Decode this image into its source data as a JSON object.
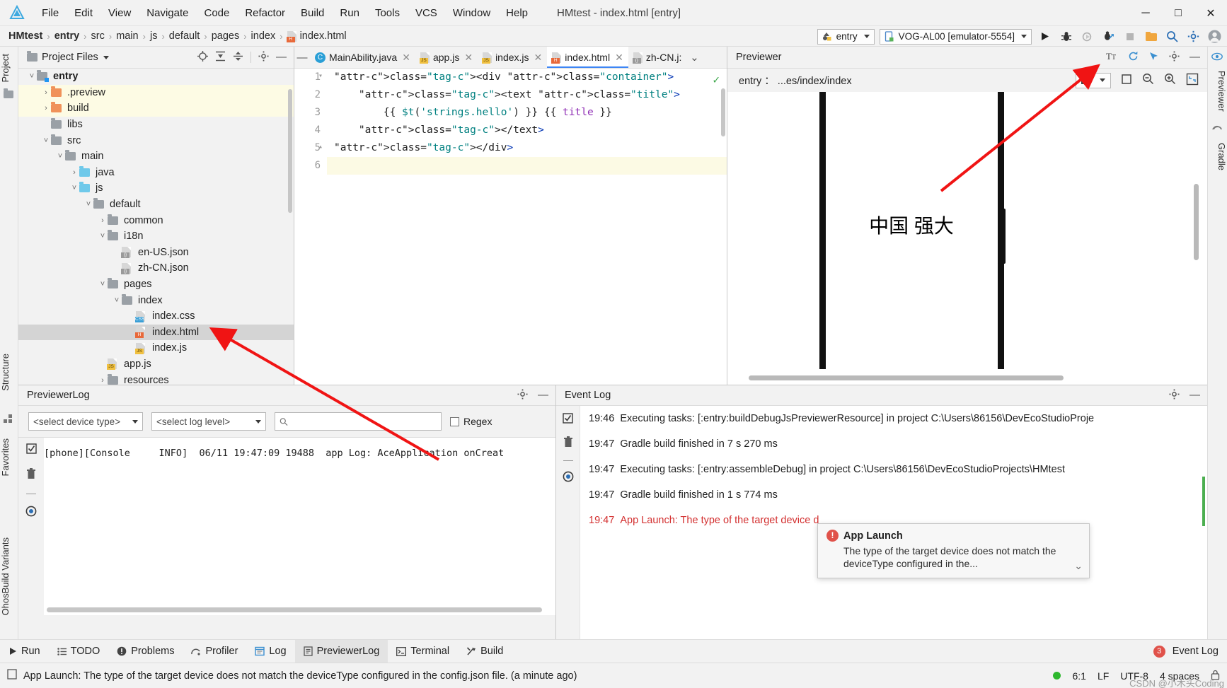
{
  "window": {
    "title": "HMtest - index.html [entry]",
    "app_icon": "deveco-studio-logo",
    "minimize": "─",
    "maximize": "□",
    "close": "✕"
  },
  "menubar": {
    "items": [
      "File",
      "Edit",
      "View",
      "Navigate",
      "Code",
      "Refactor",
      "Build",
      "Run",
      "Tools",
      "VCS",
      "Window",
      "Help"
    ]
  },
  "breadcrumb": {
    "items": [
      "HMtest",
      "entry",
      "src",
      "main",
      "js",
      "default",
      "pages",
      "index"
    ],
    "file": "index.html",
    "separator": "›"
  },
  "toolbar": {
    "run_config": "entry",
    "device": "VOG-AL00 [emulator-5554]",
    "icons": [
      "run-icon",
      "debug-icon",
      "run-coverage-icon",
      "profile-icon",
      "stop-icon",
      "device-manager-icon",
      "search-everywhere-icon",
      "settings-icon",
      "account-icon"
    ]
  },
  "left_strip": {
    "tabs": [
      "Project",
      "Structure",
      "Favorites",
      "OhosBuild Variants"
    ]
  },
  "right_strip": {
    "tabs": [
      "Previewer",
      "Gradle"
    ]
  },
  "project_panel": {
    "title": "Project Files",
    "head_icons": [
      "locate-icon",
      "expand-all-icon",
      "collapse-all-icon",
      "gear-icon",
      "hide-icon"
    ],
    "tree": [
      {
        "label": "entry",
        "depth": 0,
        "twisty": "v",
        "icon": "module-folder",
        "bold": true,
        "state": "normal"
      },
      {
        "label": ".preview",
        "depth": 1,
        "twisty": ">",
        "icon": "folder-orange",
        "bold": false,
        "state": "highlight"
      },
      {
        "label": "build",
        "depth": 1,
        "twisty": ">",
        "icon": "folder-orange",
        "bold": false,
        "state": "highlight"
      },
      {
        "label": "libs",
        "depth": 1,
        "twisty": "",
        "icon": "folder-gray",
        "bold": false,
        "state": "normal"
      },
      {
        "label": "src",
        "depth": 1,
        "twisty": "v",
        "icon": "folder-gray",
        "bold": false,
        "state": "normal"
      },
      {
        "label": "main",
        "depth": 2,
        "twisty": "v",
        "icon": "folder-gray",
        "bold": false,
        "state": "normal"
      },
      {
        "label": "java",
        "depth": 3,
        "twisty": ">",
        "icon": "folder-blue",
        "bold": false,
        "state": "normal"
      },
      {
        "label": "js",
        "depth": 3,
        "twisty": "v",
        "icon": "folder-blue",
        "bold": false,
        "state": "normal"
      },
      {
        "label": "default",
        "depth": 4,
        "twisty": "v",
        "icon": "folder-gray",
        "bold": false,
        "state": "normal"
      },
      {
        "label": "common",
        "depth": 5,
        "twisty": ">",
        "icon": "folder-gray",
        "bold": false,
        "state": "normal"
      },
      {
        "label": "i18n",
        "depth": 5,
        "twisty": "v",
        "icon": "folder-gray",
        "bold": false,
        "state": "normal"
      },
      {
        "label": "en-US.json",
        "depth": 6,
        "twisty": "",
        "icon": "file-json",
        "bold": false,
        "state": "normal"
      },
      {
        "label": "zh-CN.json",
        "depth": 6,
        "twisty": "",
        "icon": "file-json",
        "bold": false,
        "state": "normal"
      },
      {
        "label": "pages",
        "depth": 5,
        "twisty": "v",
        "icon": "folder-gray",
        "bold": false,
        "state": "normal"
      },
      {
        "label": "index",
        "depth": 6,
        "twisty": "v",
        "icon": "folder-gray",
        "bold": false,
        "state": "normal"
      },
      {
        "label": "index.css",
        "depth": 7,
        "twisty": "",
        "icon": "file-css",
        "bold": false,
        "state": "normal"
      },
      {
        "label": "index.html",
        "depth": 7,
        "twisty": "",
        "icon": "file-html",
        "bold": false,
        "state": "selected"
      },
      {
        "label": "index.js",
        "depth": 7,
        "twisty": "",
        "icon": "file-js",
        "bold": false,
        "state": "normal"
      },
      {
        "label": "app.js",
        "depth": 5,
        "twisty": "",
        "icon": "file-js",
        "bold": false,
        "state": "normal"
      },
      {
        "label": "resources",
        "depth": 5,
        "twisty": ">",
        "icon": "folder-gray",
        "bold": false,
        "state": "normal"
      }
    ]
  },
  "editor": {
    "tabs": [
      {
        "label": "MainAbility.java",
        "icon": "java-class-icon",
        "active": false
      },
      {
        "label": "app.js",
        "icon": "js-file-icon",
        "active": false
      },
      {
        "label": "index.js",
        "icon": "js-file-icon",
        "active": false
      },
      {
        "label": "index.html",
        "icon": "html-file-icon",
        "active": true
      },
      {
        "label": "zh-CN.j:",
        "icon": "json-file-icon",
        "active": false
      }
    ],
    "tab_overflow": "⌄",
    "inspection_status": "✓",
    "line_numbers": [
      "1",
      "2",
      "3",
      "4",
      "5",
      "6"
    ],
    "code": [
      {
        "n": 1,
        "text": "<div class=\"container\">",
        "indent": 0
      },
      {
        "n": 2,
        "text": "<text class=\"title\">",
        "indent": 1
      },
      {
        "n": 3,
        "text": "{{ $t('strings.hello') }} {{ title }}",
        "indent": 2
      },
      {
        "n": 4,
        "text": "</text>",
        "indent": 1
      },
      {
        "n": 5,
        "text": "</div>",
        "indent": 0
      },
      {
        "n": 6,
        "text": "",
        "indent": 0
      }
    ]
  },
  "previewer": {
    "title": "Previewer",
    "head_icons": [
      "font-size-icon",
      "refresh-icon",
      "inspector-icon",
      "gear-icon",
      "hide-icon"
    ],
    "path": "entry ： ...es/index/index",
    "toolbar_icons": [
      "multi-device-icon",
      "chevron-down-icon",
      "crop-icon",
      "zoom-out-icon",
      "zoom-in-icon",
      "fit-icon"
    ],
    "device_text": "中国 强大"
  },
  "previewer_log": {
    "title": "PreviewerLog",
    "head_icons": [
      "gear-icon",
      "hide-icon"
    ],
    "device_filter": "<select device type>",
    "level_filter": "<select log level>",
    "search_placeholder": "",
    "search_icon": "search-icon",
    "regex_label": "Regex",
    "regex_checked": false,
    "side_icons": [
      "scroll-to-end-icon",
      "trash-icon",
      "settings-circle-icon"
    ],
    "log_lines": [
      "[phone][Console     INFO]  06/11 19:47:09 19488  app Log: AceApplication onCreat"
    ]
  },
  "event_log": {
    "title": "Event Log",
    "head_icons": [
      "gear-icon",
      "hide-icon"
    ],
    "side_icons": [
      "mark-read-icon",
      "trash-icon",
      "settings-circle-icon"
    ],
    "entries": [
      {
        "time": "19:46",
        "text": "Executing tasks: [:entry:buildDebugJsPreviewerResource] in project C:\\Users\\86156\\DevEcoStudioProje",
        "error": false
      },
      {
        "time": "19:47",
        "text": "Gradle build finished in 7 s 270 ms",
        "error": false
      },
      {
        "time": "19:47",
        "text": "Executing tasks: [:entry:assembleDebug] in project C:\\Users\\86156\\DevEcoStudioProjects\\HMtest",
        "error": false
      },
      {
        "time": "19:47",
        "text": "Gradle build finished in 1 s 774 ms",
        "error": false
      },
      {
        "time": "19:47",
        "text": "App Launch: The type of the target device d",
        "error": true
      }
    ]
  },
  "balloon": {
    "icon": "error-icon",
    "title": "App Launch",
    "message": "The type of the target device does not match the deviceType configured in the...",
    "expand": "⌄"
  },
  "bottom_bar": {
    "tabs": [
      {
        "label": "Run",
        "icon": "run-icon",
        "active": false
      },
      {
        "label": "TODO",
        "icon": "todo-icon",
        "active": false
      },
      {
        "label": "Problems",
        "icon": "problems-icon",
        "active": false
      },
      {
        "label": "Profiler",
        "icon": "profiler-icon",
        "active": false
      },
      {
        "label": "Log",
        "icon": "log-icon",
        "active": false
      },
      {
        "label": "PreviewerLog",
        "icon": "previewer-log-icon",
        "active": true
      },
      {
        "label": "Terminal",
        "icon": "terminal-icon",
        "active": false
      },
      {
        "label": "Build",
        "icon": "build-icon",
        "active": false
      }
    ],
    "event_log_label": "Event Log",
    "event_count": "3"
  },
  "status_bar": {
    "icon": "memo-icon",
    "message": "App Launch: The type of the target device does not match the deviceType configured in the config.json file. (a minute ago)",
    "caret_position": "6:1",
    "line_separator": "LF",
    "encoding": "UTF-8",
    "indent": "4 spaces",
    "lock_icon": "lock-icon",
    "watermark": "CSDN @小木头Coding"
  },
  "colors": {
    "accent_blue": "#3e86f5",
    "annotation_red": "#f01414",
    "highlight_yellow": "#fdfbe4",
    "error_red": "#d32f2f",
    "success_green": "#3aa648"
  }
}
